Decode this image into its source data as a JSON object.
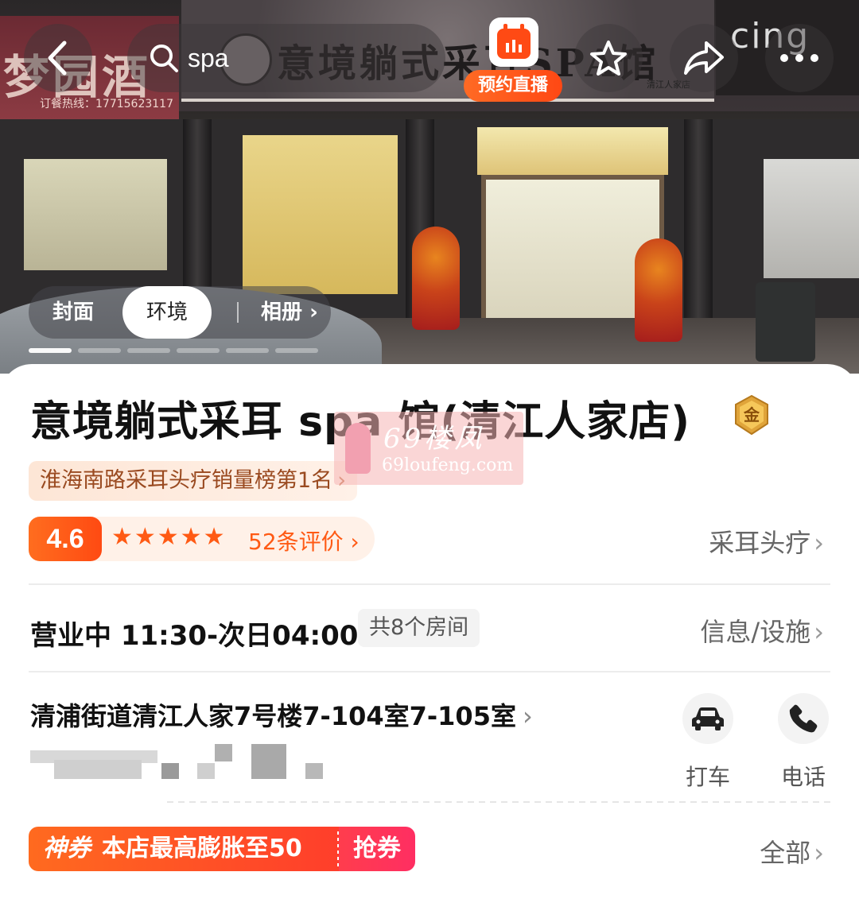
{
  "hero": {
    "left_sign_text": "梦园酒楼",
    "left_sign_phone": "订餐热线：17715623117",
    "main_sign_text": "意境躺式采耳SPA馆",
    "main_sign_sub": "清江人家店",
    "right_sign_text": "cing"
  },
  "nav": {
    "search_text": "spa",
    "live_label": "预约直播"
  },
  "photo_tabs": {
    "cover": "封面",
    "environment": "环境",
    "album": "相册",
    "album_chevron": "›"
  },
  "shop": {
    "name": "意境躺式采耳 spa 馆(清江人家店)",
    "medal_text": "金",
    "rank_badge": "淮海南路采耳头疗销量榜第1名",
    "rank_chevron": "›",
    "rating": 4.6,
    "rating_label": "4.6",
    "stars": "★★★★★",
    "review_count": "52条评价",
    "review_chevron": "›",
    "category": "采耳头疗",
    "status_hours": "营业中 11:30-次日04:00",
    "rooms": "共8个房间",
    "info_link": "信息/设施",
    "address": "清浦街道清江人家7号楼7-104室7-105室",
    "address_chevron": "›"
  },
  "actions": {
    "taxi": "打车",
    "phone": "电话"
  },
  "coupon": {
    "tag": "神券",
    "text": "本店最高膨胀至50",
    "grab": "抢券",
    "all_link": "全部"
  },
  "watermark": {
    "line1": "69楼凤",
    "line2": "69loufeng.com"
  },
  "colors": {
    "accent": "#ff5a14",
    "coupon_red": "#ff3e2b",
    "text_primary": "#111111",
    "text_secondary": "#666666"
  }
}
